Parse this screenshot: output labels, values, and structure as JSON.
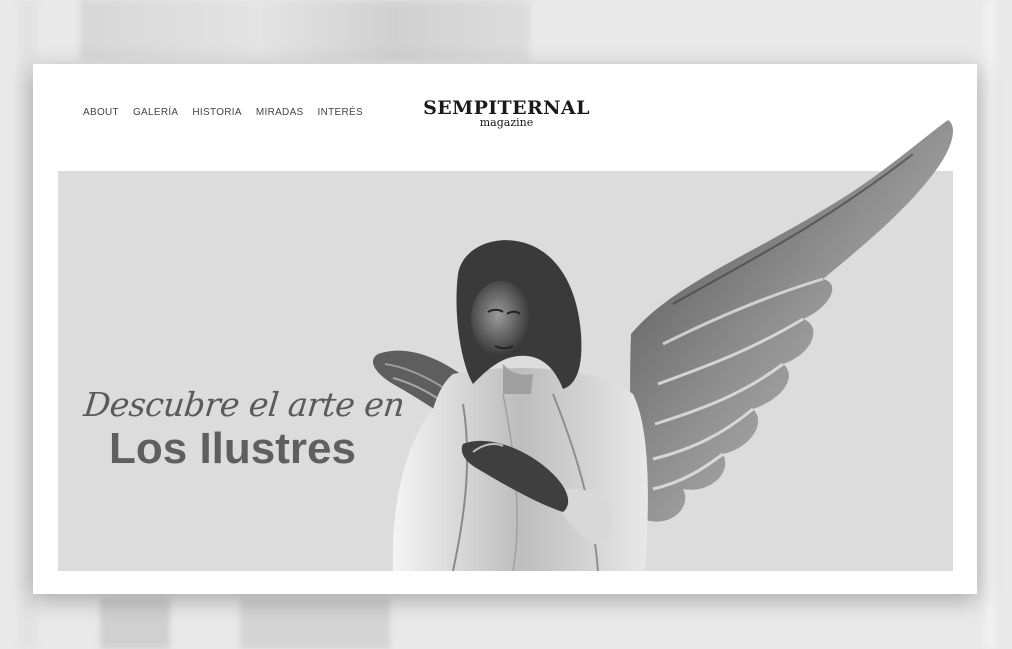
{
  "nav": {
    "items": [
      {
        "label": "ABOUT"
      },
      {
        "label": "GALERÍA"
      },
      {
        "label": "HISTORIA"
      },
      {
        "label": "MIRADAS"
      },
      {
        "label": "INTERÉS"
      }
    ]
  },
  "logo": {
    "main": "SEMPITERNAL",
    "sub": "magazine"
  },
  "hero": {
    "script_line": "Descubre el arte en",
    "title": "Los Ilustres",
    "image": "angel-statue"
  },
  "colors": {
    "hero_bg": "#dcdcdc",
    "text_dark": "#1a1a1a",
    "hero_text": "#5f5f5f"
  }
}
